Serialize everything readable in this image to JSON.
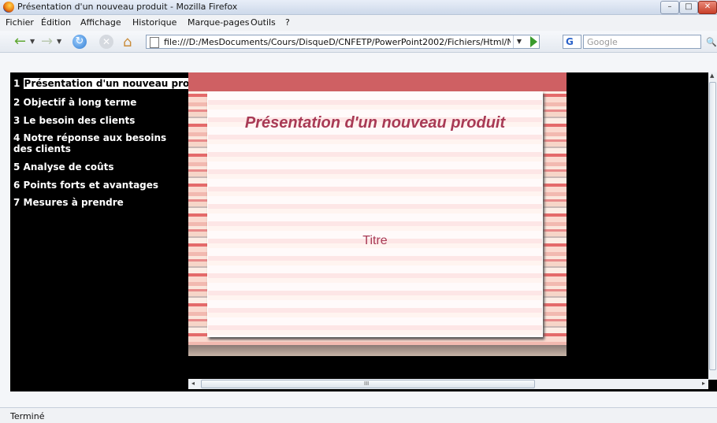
{
  "window": {
    "title": "Présentation d'un nouveau produit - Mozilla Firefox",
    "minimize": "–",
    "maximize": "□",
    "close": "✕"
  },
  "menubar": {
    "items": [
      "Fichier",
      "Édition",
      "Affichage",
      "Historique",
      "Marque-pages",
      "Outils",
      "?"
    ]
  },
  "toolbar": {
    "back_icon": "←",
    "forward_icon": "→",
    "dropdown": "▼",
    "reload_icon": "↻",
    "stop_icon": "✕",
    "home_icon": "⌂",
    "url": "file:///D:/MesDocuments/Cours/DisqueD/CNFETP/PowerPoint2002/Fichiers/Html/NvxProduit_f",
    "search_engine": "G",
    "search_placeholder": "Google",
    "search_icon": "🔍"
  },
  "outline": {
    "items": [
      {
        "num": "1",
        "label": "Présentation d'un nouveau produit"
      },
      {
        "num": "2",
        "label": "Objectif à long terme"
      },
      {
        "num": "3",
        "label": "Le besoin des clients"
      },
      {
        "num": "4",
        "label": "Notre réponse aux besoins des clients"
      },
      {
        "num": "5",
        "label": "Analyse de coûts"
      },
      {
        "num": "6",
        "label": "Points forts et avantages"
      },
      {
        "num": "7",
        "label": "Mesures à prendre"
      }
    ]
  },
  "slide": {
    "title": "Présentation d'un nouveau produit",
    "subtitle": "Titre"
  },
  "scrollbars": {
    "grip": "III"
  },
  "status": {
    "text": "Terminé"
  }
}
